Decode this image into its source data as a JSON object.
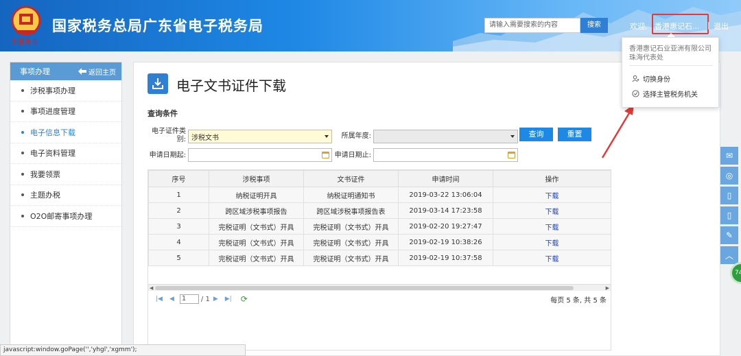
{
  "header": {
    "emblem_script": "中国税务",
    "title": "国家税务总局广东省电子税务局",
    "search_placeholder": "请输入需要搜索的内容",
    "search_button": "搜索",
    "welcome": "欢迎,",
    "user": "香港惠记石...",
    "separator": "|",
    "logout": "退出"
  },
  "user_menu": {
    "company": "香港惠记石业亚洲有限公司珠海代表处",
    "items": [
      {
        "label": "切换身份",
        "icon": "user-icon"
      },
      {
        "label": "选择主管税务机关",
        "icon": "check-circle-icon"
      }
    ]
  },
  "sidebar": {
    "heading": "事项办理",
    "back_label": "返回主页",
    "items": [
      {
        "label": "涉税事项办理",
        "active": false
      },
      {
        "label": "事项进度管理",
        "active": false
      },
      {
        "label": "电子信息下载",
        "active": true
      },
      {
        "label": "电子资料管理",
        "active": false
      },
      {
        "label": "我要领票",
        "active": false
      },
      {
        "label": "主题办税",
        "active": false
      },
      {
        "label": "O2O邮寄事项办理",
        "active": false
      }
    ]
  },
  "main": {
    "title": "电子文书证件下载",
    "section": "查询条件",
    "form": {
      "type_label_1": "电子证件类",
      "type_label_2": "别:",
      "type_value": "涉税文书",
      "year_label": "所属年度:",
      "year_value": "",
      "query_button": "查询",
      "reset_button": "重置",
      "start_label": "申请日期起:",
      "end_label": "申请日期止:"
    },
    "table": {
      "headers": [
        "序号",
        "涉税事项",
        "文书证件",
        "申请时间",
        "操作"
      ],
      "rows": [
        [
          "1",
          "纳税证明开具",
          "纳税证明通知书",
          "2019-03-22 13:06:04",
          "下载"
        ],
        [
          "2",
          "跨区域涉税事项报告",
          "跨区域涉税事项报告表",
          "2019-03-14 17:23:58",
          "下载"
        ],
        [
          "3",
          "完税证明（文书式）开具",
          "完税证明（文书式）开具",
          "2019-02-20 19:27:47",
          "下载"
        ],
        [
          "4",
          "完税证明（文书式）开具",
          "完税证明（文书式）开具",
          "2019-02-19 10:38:26",
          "下载"
        ],
        [
          "5",
          "完税证明（文书式）开具",
          "完税证明（文书式）开具",
          "2019-02-19 10:37:58",
          "下载"
        ]
      ]
    },
    "pager": {
      "page": "1",
      "total_pages": "/ 1",
      "summary": "每页 5 条, 共 5 条"
    }
  },
  "side_widget": {
    "badge": "74"
  },
  "statusbar": "javascript:window.goPage('','yhgl','xgmm');",
  "colors": {
    "primary": "#1e88e5",
    "sidebar_head": "#5b9bd5",
    "highlight": "#e53935",
    "link": "#1a3fd1"
  }
}
